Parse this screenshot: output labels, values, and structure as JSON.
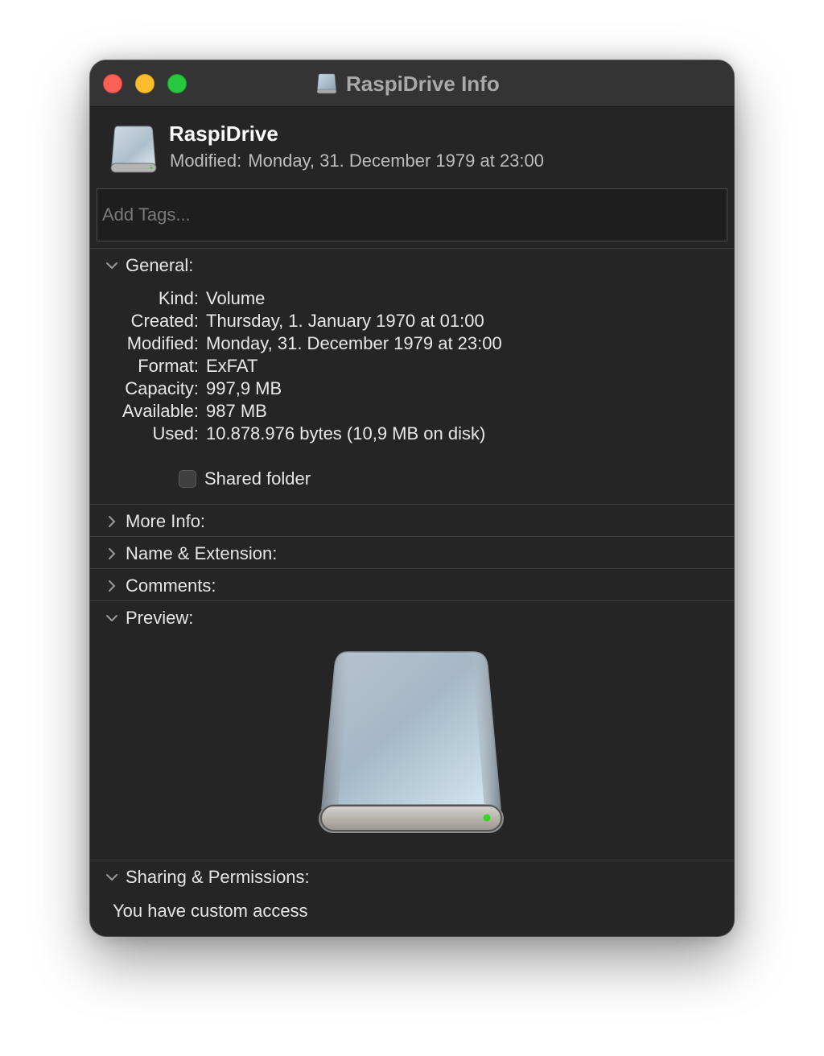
{
  "window": {
    "title": "RaspiDrive Info"
  },
  "header": {
    "name": "RaspiDrive",
    "modified_label": "Modified:",
    "modified_value": "Monday, 31. December 1979 at 23:00",
    "icon": "external-drive-icon"
  },
  "tags": {
    "placeholder": "Add Tags..."
  },
  "sections": {
    "general": {
      "label": "General:",
      "expanded": true
    },
    "more_info": {
      "label": "More Info:",
      "expanded": false
    },
    "name_extension": {
      "label": "Name & Extension:",
      "expanded": false
    },
    "comments": {
      "label": "Comments:",
      "expanded": false
    },
    "preview": {
      "label": "Preview:",
      "expanded": true
    },
    "sharing": {
      "label": "Sharing & Permissions:",
      "expanded": true
    }
  },
  "general": {
    "rows": [
      {
        "key": "Kind:",
        "value": "Volume"
      },
      {
        "key": "Created:",
        "value": "Thursday, 1. January 1970 at 01:00"
      },
      {
        "key": "Modified:",
        "value": "Monday, 31. December 1979 at 23:00"
      },
      {
        "key": "Format:",
        "value": "ExFAT"
      },
      {
        "key": "Capacity:",
        "value": "997,9 MB"
      },
      {
        "key": "Available:",
        "value": "987 MB"
      },
      {
        "key": "Used:",
        "value": "10.878.976 bytes (10,9 MB on disk)"
      }
    ],
    "shared_folder_label": "Shared folder",
    "shared_folder_checked": false
  },
  "sharing": {
    "access_text": "You have custom access"
  },
  "colors": {
    "window_bg": "#252525",
    "titlebar_bg": "#343434",
    "close": "#fe5f57",
    "minimize": "#febc2e",
    "zoom": "#28c840",
    "drive_led": "#35d52a"
  }
}
